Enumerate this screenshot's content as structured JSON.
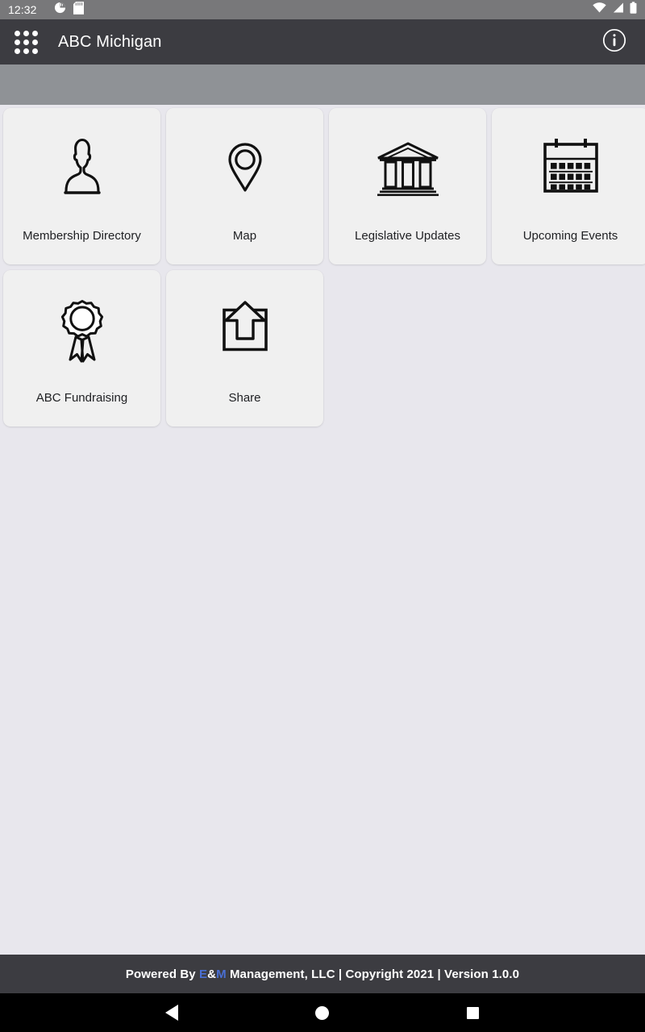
{
  "status_bar": {
    "time": "12:32",
    "left_icons": [
      "pie-chart-icon",
      "sd-card-icon"
    ],
    "right_icons": [
      "wifi-icon",
      "signal-icon",
      "battery-icon"
    ]
  },
  "app_bar": {
    "drawer_icon": "apps-grid-icon",
    "title": "ABC Michigan",
    "info_icon": "info-circle-icon"
  },
  "tiles": [
    {
      "label": "Membership Directory",
      "icon": "person-silhouette-icon"
    },
    {
      "label": "Map",
      "icon": "location-pin-icon"
    },
    {
      "label": "Legislative Updates",
      "icon": "government-building-icon"
    },
    {
      "label": "Upcoming Events",
      "icon": "calendar-icon"
    },
    {
      "label": "ABC Fundraising",
      "icon": "award-ribbon-icon"
    },
    {
      "label": "Share",
      "icon": "share-upload-icon"
    }
  ],
  "footer": {
    "prefix": "Powered By ",
    "brand_e": "E",
    "brand_amp": "&",
    "brand_m": "M",
    "suffix": " Management, LLC | Copyright 2021 | Version 1.0.0",
    "brand_color": "#4a6fd4"
  },
  "nav_bar": {
    "back_label": "back-button",
    "home_label": "home-button",
    "recents_label": "recents-button"
  },
  "colors": {
    "status_bar_bg": "#78787a",
    "app_bar_bg": "#3c3c41",
    "band_bg": "#8f9296",
    "page_bg": "#e8e7ed",
    "tile_bg": "#f0f0f0",
    "footer_bg": "#3c3c41",
    "nav_bg": "#000000"
  }
}
